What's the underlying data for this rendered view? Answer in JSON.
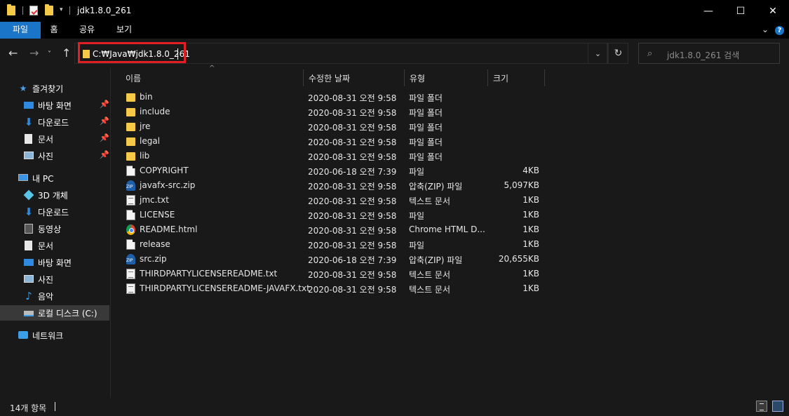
{
  "window": {
    "title": "jdk1.8.0_261",
    "controls": {
      "minimize": "—",
      "maximize": "☐",
      "close": "✕"
    }
  },
  "ribbon": {
    "tabs": [
      "파일",
      "홈",
      "공유",
      "보기"
    ],
    "active_tab": "파일",
    "collapse_icon": "chevron-down-icon",
    "help_icon": "help-icon"
  },
  "nav": {
    "address_path": "C:₩Java₩jdk1.8.0_261",
    "search_placeholder": "jdk1.8.0_261 검색"
  },
  "sidebar": {
    "quick_access": {
      "label": "즐겨찾기",
      "items": [
        {
          "label": "바탕 화면",
          "icon": "desktop-icon",
          "pinned": true
        },
        {
          "label": "다운로드",
          "icon": "download-icon",
          "pinned": true
        },
        {
          "label": "문서",
          "icon": "document-icon",
          "pinned": true
        },
        {
          "label": "사진",
          "icon": "picture-icon",
          "pinned": true
        }
      ]
    },
    "this_pc": {
      "label": "내 PC",
      "items": [
        {
          "label": "3D 개체",
          "icon": "3d-objects-icon"
        },
        {
          "label": "다운로드",
          "icon": "download-icon"
        },
        {
          "label": "동영상",
          "icon": "video-icon"
        },
        {
          "label": "문서",
          "icon": "document-icon"
        },
        {
          "label": "바탕 화면",
          "icon": "desktop-icon"
        },
        {
          "label": "사진",
          "icon": "picture-icon"
        },
        {
          "label": "음악",
          "icon": "music-icon"
        },
        {
          "label": "로컬 디스크 (C:)",
          "icon": "drive-icon",
          "selected": true
        }
      ]
    },
    "network": {
      "label": "네트워크",
      "icon": "network-icon"
    }
  },
  "file_list": {
    "columns": [
      "이름",
      "수정한 날짜",
      "유형",
      "크기"
    ],
    "rows": [
      {
        "name": "bin",
        "date": "2020-08-31 오전 9:58",
        "type": "파일 폴더",
        "size": "",
        "icon": "folder"
      },
      {
        "name": "include",
        "date": "2020-08-31 오전 9:58",
        "type": "파일 폴더",
        "size": "",
        "icon": "folder"
      },
      {
        "name": "jre",
        "date": "2020-08-31 오전 9:58",
        "type": "파일 폴더",
        "size": "",
        "icon": "folder"
      },
      {
        "name": "legal",
        "date": "2020-08-31 오전 9:58",
        "type": "파일 폴더",
        "size": "",
        "icon": "folder"
      },
      {
        "name": "lib",
        "date": "2020-08-31 오전 9:58",
        "type": "파일 폴더",
        "size": "",
        "icon": "folder"
      },
      {
        "name": "COPYRIGHT",
        "date": "2020-06-18 오전 7:39",
        "type": "파일",
        "size": "4KB",
        "icon": "file"
      },
      {
        "name": "javafx-src.zip",
        "date": "2020-08-31 오전 9:58",
        "type": "압축(ZIP) 파일",
        "size": "5,097KB",
        "icon": "zip"
      },
      {
        "name": "jmc.txt",
        "date": "2020-08-31 오전 9:58",
        "type": "텍스트 문서",
        "size": "1KB",
        "icon": "txt"
      },
      {
        "name": "LICENSE",
        "date": "2020-08-31 오전 9:58",
        "type": "파일",
        "size": "1KB",
        "icon": "file"
      },
      {
        "name": "README.html",
        "date": "2020-08-31 오전 9:58",
        "type": "Chrome HTML D...",
        "size": "1KB",
        "icon": "chrome"
      },
      {
        "name": "release",
        "date": "2020-08-31 오전 9:58",
        "type": "파일",
        "size": "1KB",
        "icon": "file"
      },
      {
        "name": "src.zip",
        "date": "2020-06-18 오전 7:39",
        "type": "압축(ZIP) 파일",
        "size": "20,655KB",
        "icon": "zip"
      },
      {
        "name": "THIRDPARTYLICENSEREADME.txt",
        "date": "2020-08-31 오전 9:58",
        "type": "텍스트 문서",
        "size": "1KB",
        "icon": "txt"
      },
      {
        "name": "THIRDPARTYLICENSEREADME-JAVAFX.txt",
        "date": "2020-08-31 오전 9:58",
        "type": "텍스트 문서",
        "size": "1KB",
        "icon": "txt"
      }
    ]
  },
  "status": {
    "item_count": "14개 항목"
  },
  "colors": {
    "accent": "#1a74c8",
    "highlight_box": "#e31e24",
    "folder": "#f7c948",
    "background": "#191919"
  }
}
